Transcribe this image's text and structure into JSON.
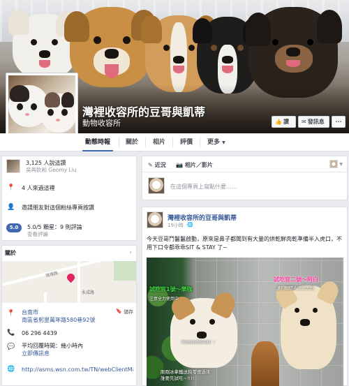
{
  "page": {
    "name": "灣裡收容所的豆哥與凱蒂",
    "category": "動物收容所"
  },
  "cover_buttons": {
    "like": "讚",
    "message": "發訊息",
    "more": "···"
  },
  "tabs": [
    {
      "label": "動態時報",
      "active": true
    },
    {
      "label": "關於"
    },
    {
      "label": "相片"
    },
    {
      "label": "評價"
    },
    {
      "label": "更多"
    }
  ],
  "sidebar": {
    "likes_count": "3,125 人說這讚",
    "likes_friends": "吳再欽和 Geomy Liu",
    "visits": "4 人來過這裡",
    "invite": "邀請朋友對這個粉絲專頁按讚",
    "rating_badge": "5.0",
    "rating_text": "5.0/5 顆星：9 則評論",
    "rating_link": "查看評論",
    "about_label": "關於",
    "map_road": "灣裡路",
    "map_road2": "永成路",
    "city": "台南市",
    "address": "南區省躬里萬年路580巷92號",
    "save_label": "儲存",
    "phone": "06 296 4439",
    "response_time": "平均回覆時間：幾小時內",
    "send_message": "立即傳訊息",
    "website": "http://asms.wsn.com.tw/TN/webClientMain.a..."
  },
  "composer": {
    "tab_status": "近況",
    "tab_photo": "相片／影片",
    "placeholder": "在這個專頁上寫點什麼……"
  },
  "post": {
    "author": "灣裡收容所的豆哥與凱蒂",
    "time": "19小時",
    "text": "今天豆哥鬥鬣鬣啟動，原來是鼻子都聞到有大量的烘乾鮮肉乾準備半入虎口，不用下口令都乖乖SIT & STAY 了~",
    "caption_left_title": "試吃官1號～樂咖",
    "caption_left_sub": "注意全力使用中",
    "caption_right_title": "試吃官二號～阿白",
    "caption_right_sub": "濃狗眼睛永汪汪大眼",
    "caption_mid": "（旁邊好狗狗都看我！）",
    "caption_bottom": "剛剛冰拿鐵送狗零食過來\n誰要先試吃~!!!!"
  },
  "colors": {
    "brand": "#4267b2",
    "link": "#365899",
    "bg": "#e9ebee",
    "caption_green": "#3fcf3f",
    "caption_pink": "#ff3fa0"
  }
}
